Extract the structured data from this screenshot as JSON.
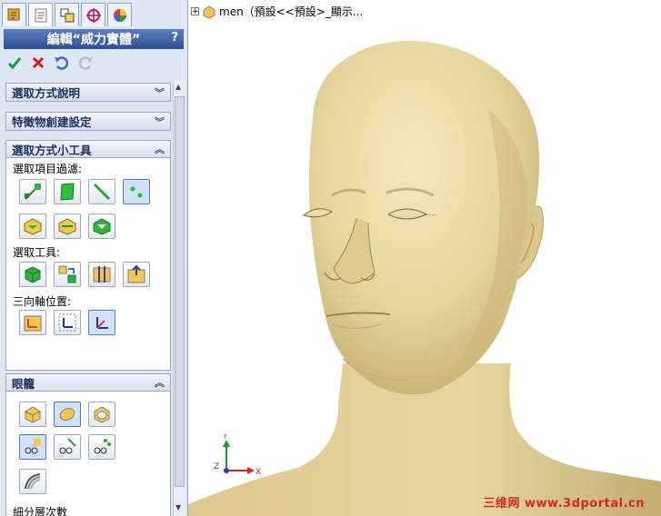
{
  "tabs": [
    {
      "icon": "feature-manager-icon"
    },
    {
      "icon": "property-manager-icon"
    },
    {
      "icon": "configuration-manager-icon"
    },
    {
      "icon": "dimxpert-icon"
    },
    {
      "icon": "display-manager-icon"
    }
  ],
  "panel": {
    "title": "編輯“威力實體”",
    "help": "?",
    "ok_icon": "checkmark-icon",
    "cancel_icon": "x-icon",
    "undo_icon": "undo-icon",
    "redo_icon": "redo-icon"
  },
  "groups": {
    "selection_help": {
      "label": "選取方式說明",
      "collapsed": true
    },
    "feature_creation": {
      "label": "特徵物創建設定",
      "collapsed": true
    },
    "selection_tools": {
      "label": "選取方式小工具",
      "filter_label": "選取項目過濾:",
      "tools_label": "選取工具:",
      "triad_label": "三向軸位置:"
    },
    "cage": {
      "label": "眼籠",
      "subdivision_label": "細分層次數"
    }
  },
  "tree": {
    "text": "men（預設<<預設>_顯示..."
  },
  "triad": {
    "x": "X",
    "y": "Y",
    "z": "Z"
  },
  "watermark": "三维网 www.3dportal.cn",
  "colors": {
    "skin": "#e8d8a2",
    "panel_bg": "#dde6f3",
    "title_bar": "#3a5ca3"
  }
}
